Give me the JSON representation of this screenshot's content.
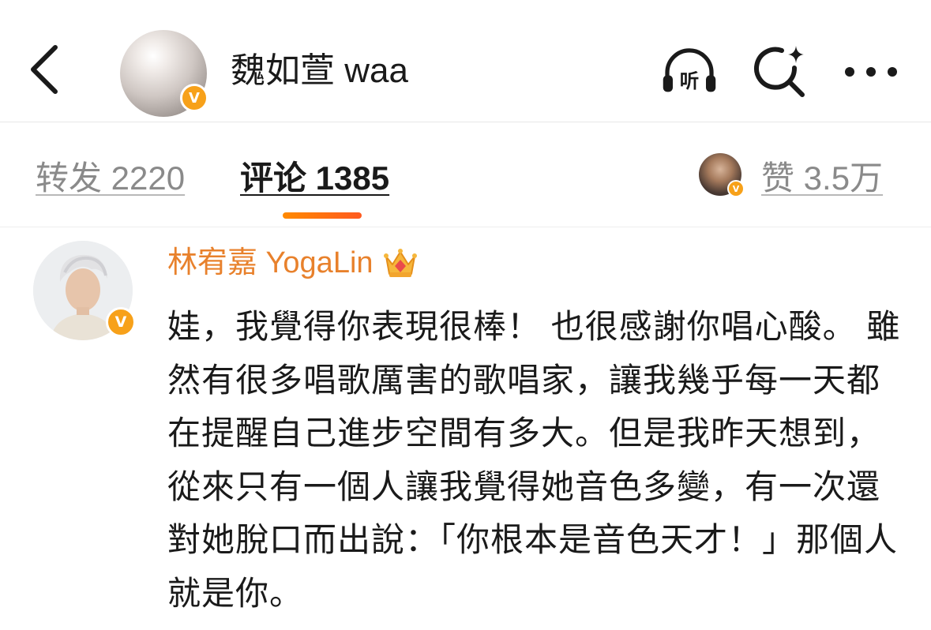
{
  "header": {
    "back_icon": "chevron-left-icon",
    "title": "魏如萱 waa",
    "avatar_icon": "pearl-avatar",
    "verified_badge": "V",
    "listen_label": "听",
    "search_icon": "search-sparkle-icon",
    "more_icon": "more-dots-icon"
  },
  "tabs": {
    "repost": "转发 2220",
    "comment": "评论 1385",
    "like": "赞 3.5万",
    "liker_badge": "V"
  },
  "comment": {
    "author": "林宥嘉 YogaLin",
    "author_badge": "V",
    "crown_icon": "crown-icon",
    "text": "娃，我覺得你表現很棒！ 也很感謝你唱心酸。 雖然有很多唱歌厲害的歌唱家，讓我幾乎每一天都在提醒自己進步空間有多大。但是我昨天想到，從來只有一個人讓我覺得她音色多變，有一次還對她脫口而出說：「你根本是音色天才！」那個人就是你。"
  },
  "colors": {
    "accent_orange": "#e8812c",
    "badge": "#f7a11a",
    "tab_indicator": "#ff7a10"
  }
}
